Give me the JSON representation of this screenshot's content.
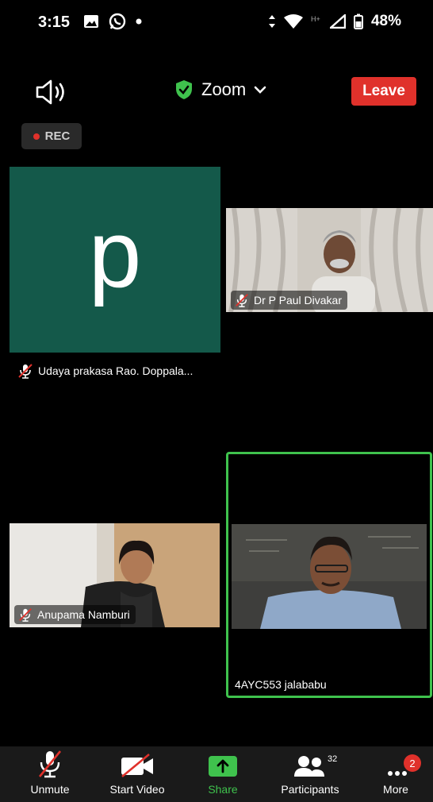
{
  "status_bar": {
    "time": "3:15",
    "battery": "48%"
  },
  "meeting": {
    "title": "Zoom",
    "leave_label": "Leave",
    "rec_label": "REC"
  },
  "participants": {
    "udaya": {
      "initial": "p",
      "name": "Udaya prakasa Rao. Doppala..."
    },
    "paul": {
      "name": "Dr P Paul Divakar"
    },
    "anupama": {
      "name": "Anupama Namburi"
    },
    "jalababu": {
      "name": "4AYC553 jalababu"
    }
  },
  "toolbar": {
    "unmute": "Unmute",
    "start_video": "Start Video",
    "share": "Share",
    "participants": "Participants",
    "participants_count": "32",
    "more": "More",
    "more_badge": "2"
  },
  "colors": {
    "accent": "#3fc24d",
    "leave": "#e0312b",
    "tile_bg": "#14594a"
  }
}
